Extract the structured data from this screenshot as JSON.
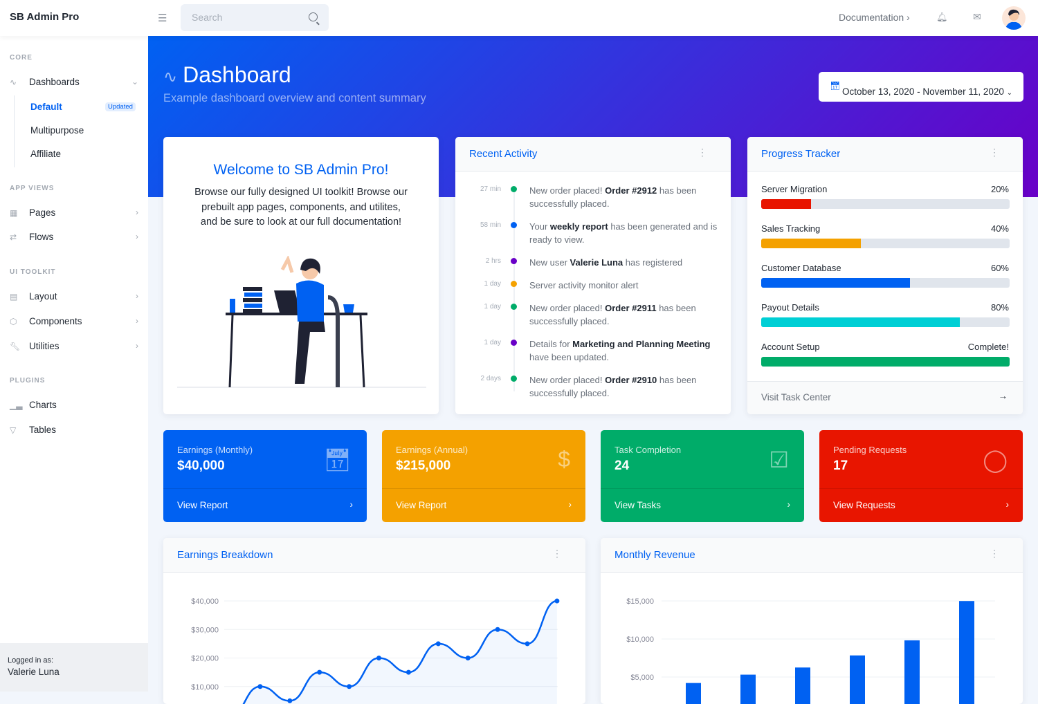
{
  "topbar": {
    "brand": "SB Admin Pro",
    "search_placeholder": "Search",
    "documentation": "Documentation ›"
  },
  "sidebar": {
    "sections": [
      "CORE",
      "APP VIEWS",
      "UI TOOLKIT",
      "PLUGINS"
    ],
    "dashboards": "Dashboards",
    "sub": [
      "Default",
      "Multipurpose",
      "Affiliate"
    ],
    "badge": "Updated",
    "items": [
      "Pages",
      "Flows",
      "Layout",
      "Components",
      "Utilities",
      "Charts",
      "Tables"
    ],
    "footer_label": "Logged in as:",
    "footer_user": "Valerie Luna"
  },
  "header": {
    "title": "Dashboard",
    "subtitle": "Example dashboard overview and content summary",
    "date_range": "October 13, 2020 - November 11, 2020"
  },
  "welcome": {
    "title": "Welcome to SB Admin Pro!",
    "text": "Browse our fully designed UI toolkit! Browse our prebuilt app pages, components, and utilites, and be sure to look at our full documentation!"
  },
  "activity": {
    "title": "Recent Activity",
    "items": [
      {
        "time": "27 min",
        "color": "#00ac69",
        "pre": "New order placed! ",
        "bold": "Order #2912",
        "post": " has been successfully placed."
      },
      {
        "time": "58 min",
        "color": "#0061f2",
        "pre": "Your ",
        "bold": "weekly report",
        "post": " has been generated and is ready to view."
      },
      {
        "time": "2 hrs",
        "color": "#6900c7",
        "pre": "New user ",
        "bold": "Valerie Luna",
        "post": " has registered"
      },
      {
        "time": "1 day",
        "color": "#f4a100",
        "pre": "Server activity monitor alert",
        "bold": "",
        "post": ""
      },
      {
        "time": "1 day",
        "color": "#00ac69",
        "pre": "New order placed! ",
        "bold": "Order #2911",
        "post": " has been successfully placed."
      },
      {
        "time": "1 day",
        "color": "#6900c7",
        "pre": "Details for ",
        "bold": "Marketing and Planning Meeting",
        "post": " have been updated."
      },
      {
        "time": "2 days",
        "color": "#00ac69",
        "pre": "New order placed! ",
        "bold": "Order #2910",
        "post": " has been successfully placed."
      }
    ]
  },
  "progress": {
    "title": "Progress Tracker",
    "footer": "Visit Task Center",
    "items": [
      {
        "label": "Server Migration",
        "value": "20%",
        "percent": 20,
        "color": "#e81500"
      },
      {
        "label": "Sales Tracking",
        "value": "40%",
        "percent": 40,
        "color": "#f4a100"
      },
      {
        "label": "Customer Database",
        "value": "60%",
        "percent": 60,
        "color": "#0061f2"
      },
      {
        "label": "Payout Details",
        "value": "80%",
        "percent": 80,
        "color": "#00cfd5"
      },
      {
        "label": "Account Setup",
        "value": "Complete!",
        "percent": 100,
        "color": "#00ac69"
      }
    ]
  },
  "stats": [
    {
      "label": "Earnings (Monthly)",
      "value": "$40,000",
      "link": "View Report",
      "color": "#0061f2",
      "icon": "calendar-icon"
    },
    {
      "label": "Earnings (Annual)",
      "value": "$215,000",
      "link": "View Report",
      "color": "#f4a100",
      "icon": "dollar-icon"
    },
    {
      "label": "Task Completion",
      "value": "24",
      "link": "View Tasks",
      "color": "#00ac69",
      "icon": "check-square-icon"
    },
    {
      "label": "Pending Requests",
      "value": "17",
      "link": "View Requests",
      "color": "#e81500",
      "icon": "message-circle-icon"
    }
  ],
  "chart_data": [
    {
      "type": "area",
      "title": "Earnings Breakdown",
      "y_ticks": [
        "$10,000",
        "$20,000",
        "$30,000",
        "$40,000"
      ],
      "ylim": [
        0,
        40000
      ],
      "grid": true,
      "values": [
        0,
        10000,
        5000,
        15000,
        10000,
        20000,
        15000,
        25000,
        20000,
        30000,
        25000,
        40000
      ],
      "color": "#0061f2"
    },
    {
      "type": "bar",
      "title": "Monthly Revenue",
      "y_ticks": [
        "$5,000",
        "$10,000",
        "$15,000"
      ],
      "ylim": [
        0,
        15000
      ],
      "grid": true,
      "values": [
        4215,
        5312,
        6251,
        7841,
        9821,
        14984
      ],
      "color": "#0061f2"
    }
  ]
}
